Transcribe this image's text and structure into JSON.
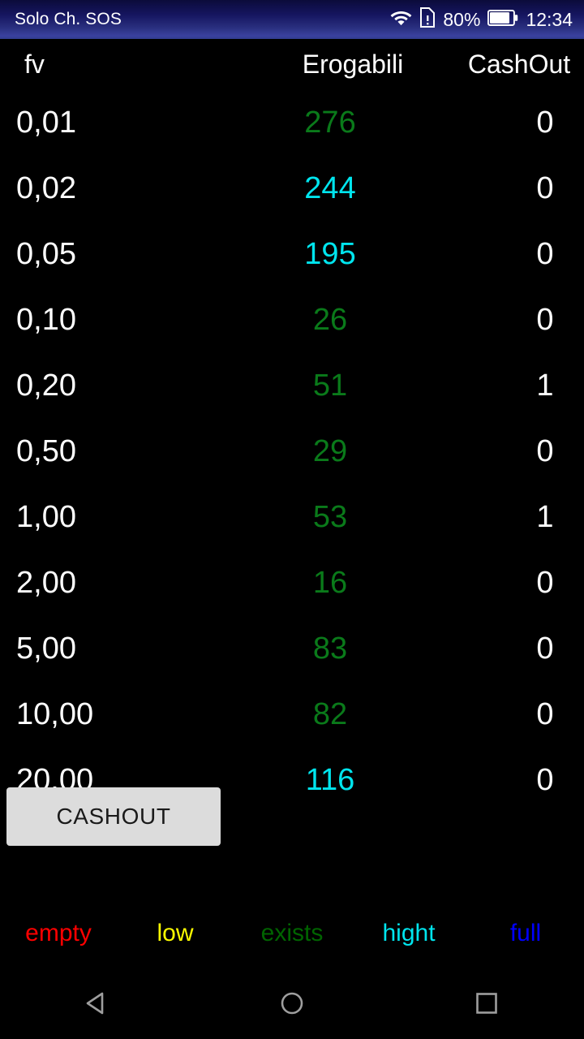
{
  "status_bar": {
    "carrier_label": "Solo Ch. SOS",
    "wifi_icon": "wifi-icon",
    "sim_icon": "sim-card-alert-icon",
    "battery_percent": "80%",
    "battery_icon": "battery-icon",
    "clock": "12:34"
  },
  "table": {
    "headers": {
      "fv": "fv",
      "erogabili": "Erogabili",
      "cashout": "CashOut"
    },
    "rows": [
      {
        "fv": "0,01",
        "erogabili": "276",
        "erogabili_color": "#0a7a1a",
        "cashout": "0"
      },
      {
        "fv": "0,02",
        "erogabili": "244",
        "erogabili_color": "#00e5ee",
        "cashout": "0"
      },
      {
        "fv": "0,05",
        "erogabili": "195",
        "erogabili_color": "#00e5ee",
        "cashout": "0"
      },
      {
        "fv": "0,10",
        "erogabili": "26",
        "erogabili_color": "#0a7a1a",
        "cashout": "0"
      },
      {
        "fv": "0,20",
        "erogabili": "51",
        "erogabili_color": "#0a7a1a",
        "cashout": "1"
      },
      {
        "fv": "0,50",
        "erogabili": "29",
        "erogabili_color": "#0a7a1a",
        "cashout": "0"
      },
      {
        "fv": "1,00",
        "erogabili": "53",
        "erogabili_color": "#0a7a1a",
        "cashout": "1"
      },
      {
        "fv": "2,00",
        "erogabili": "16",
        "erogabili_color": "#0a7a1a",
        "cashout": "0"
      },
      {
        "fv": "5,00",
        "erogabili": "83",
        "erogabili_color": "#0a7a1a",
        "cashout": "0"
      },
      {
        "fv": "10,00",
        "erogabili": "82",
        "erogabili_color": "#0a7a1a",
        "cashout": "0"
      },
      {
        "fv": "20.00",
        "erogabili": "116",
        "erogabili_color": "#00e5ee",
        "cashout": "0"
      }
    ]
  },
  "cashout_button": {
    "label": "CASHOUT"
  },
  "legend": [
    {
      "label": "empty",
      "color": "#ff0000"
    },
    {
      "label": "low",
      "color": "#ffff00"
    },
    {
      "label": "exists",
      "color": "#006400"
    },
    {
      "label": "hight",
      "color": "#00e5ee"
    },
    {
      "label": "full",
      "color": "#0000ff"
    }
  ],
  "nav_bar": {
    "back": "back-icon",
    "home": "home-icon",
    "recents": "recents-icon"
  },
  "colors": {
    "background": "#000000",
    "status_bar_accent": "#313d8f",
    "text_primary": "#ffffff",
    "button_face": "#dcdcdc"
  }
}
